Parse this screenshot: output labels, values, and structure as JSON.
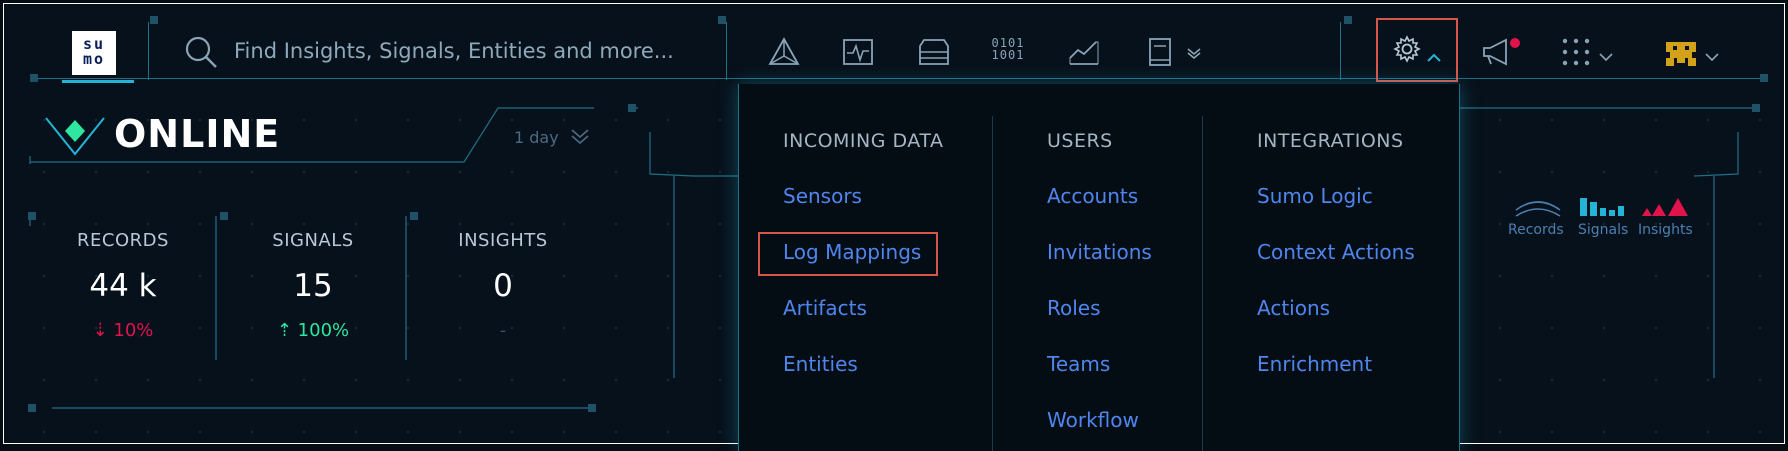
{
  "app": {
    "logo_text_top": "su",
    "logo_text_bottom": "mo"
  },
  "search": {
    "placeholder": "Find Insights, Signals, Entities and more..."
  },
  "toolbar": {
    "binary_icon_line1": "0101",
    "binary_icon_line2": "1001"
  },
  "status": {
    "title": "ONLINE",
    "period": "1 day"
  },
  "stats": [
    {
      "label": "RECORDS",
      "value": "44 k",
      "delta": "10%",
      "trend": "down"
    },
    {
      "label": "SIGNALS",
      "value": "15",
      "delta": "100%",
      "trend": "up"
    },
    {
      "label": "INSIGHTS",
      "value": "0",
      "delta": "-",
      "trend": "none"
    }
  ],
  "legend": {
    "records": "Records",
    "signals": "Signals",
    "insights": "Insights"
  },
  "settings_menu": {
    "columns": [
      {
        "heading": "INCOMING DATA",
        "items": [
          "Sensors",
          "Log Mappings",
          "Artifacts",
          "Entities"
        ]
      },
      {
        "heading": "USERS",
        "items": [
          "Accounts",
          "Invitations",
          "Roles",
          "Teams",
          "Workflow"
        ]
      },
      {
        "heading": "INTEGRATIONS",
        "items": [
          "Sumo Logic",
          "Context Actions",
          "Actions",
          "Enrichment"
        ]
      }
    ]
  },
  "colors": {
    "accent": "#23b4d6",
    "link": "#4f86ee",
    "highlight": "#d6574a",
    "negative": "#e0134a",
    "positive": "#2ee6a0",
    "online_diamond": "#2ee6a0"
  }
}
